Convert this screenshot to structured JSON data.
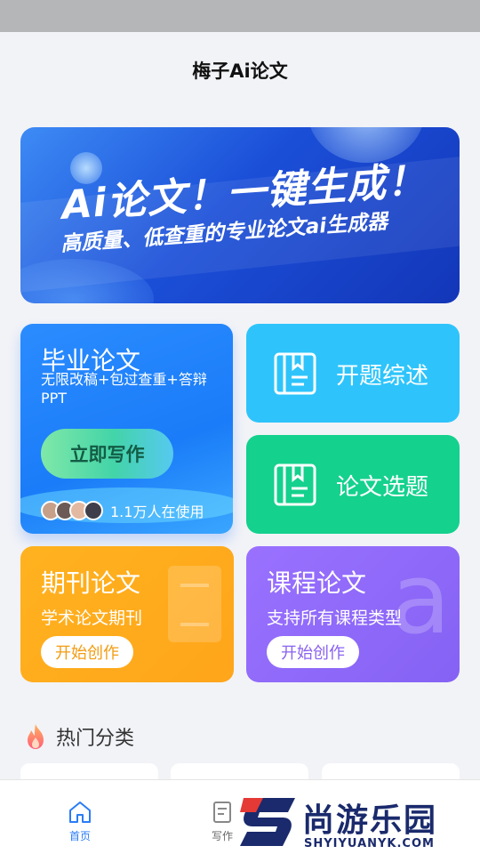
{
  "header": {
    "title": "梅子Ai论文"
  },
  "banner": {
    "headline": "Ai论文！一键生成！",
    "subline": "高质量、低查重的专业论文ai生成器"
  },
  "cards": {
    "graduation": {
      "title": "毕业论文",
      "desc": "无限改稿+包过查重+答辩PPT",
      "cta": "立即写作",
      "users_text": "1.1万人在使用"
    },
    "opening": {
      "label": "开题综述"
    },
    "topic": {
      "label": "论文选题"
    },
    "journal": {
      "title": "期刊论文",
      "desc": "学术论文期刊",
      "button": "开始创作"
    },
    "course": {
      "title": "课程论文",
      "desc": "支持所有课程类型",
      "button": "开始创作",
      "bg_glyph": "a"
    }
  },
  "hot": {
    "title": "热门分类"
  },
  "tabbar": {
    "items": [
      {
        "label": "首页",
        "icon": "home-icon",
        "active": true
      },
      {
        "label": "写作",
        "icon": "write-icon",
        "active": false
      }
    ]
  },
  "watermark": {
    "title": "尚游乐园",
    "subtitle": "SHYIYUANYK.COM"
  },
  "colors": {
    "accent": "#2a7cf6",
    "graduation": "#1a7cf8",
    "opening": "#2ec4fb",
    "topic": "#14d18e",
    "journal": "#ffb21f",
    "course": "#8a62f0"
  }
}
